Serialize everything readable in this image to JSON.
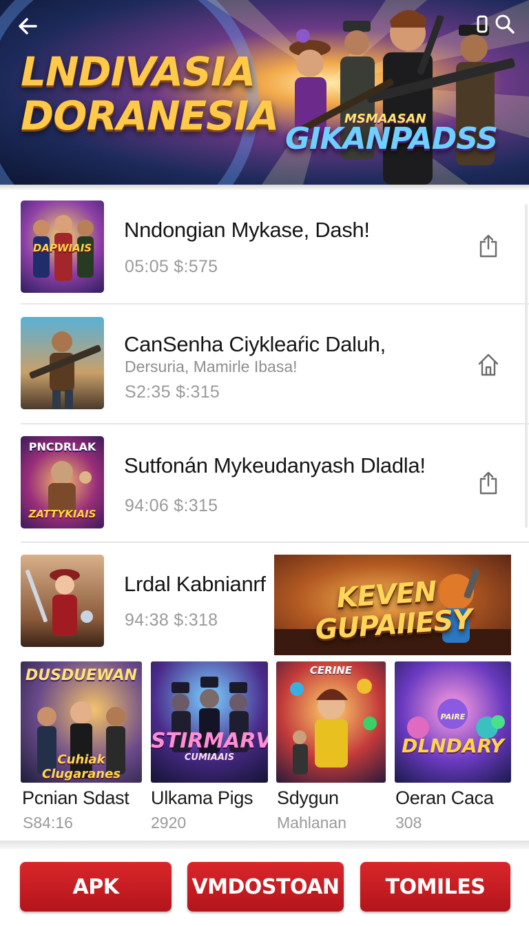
{
  "header": {
    "back_icon": "arrow-left-icon",
    "icons": [
      "phone-icon",
      "search-icon"
    ],
    "banner_title_line1": "LNDIVASIA",
    "banner_title_line2": "DORANESIA",
    "banner_logo_small": "MSMAASAN",
    "banner_logo": "GIKANPADSS"
  },
  "list": {
    "items": [
      {
        "title": "Nndongian Mykase, Dash!",
        "subtitle": "",
        "meta": "05:05  $:575",
        "thumb_text": "DAPWIAIS",
        "action_icon": "share-icon"
      },
      {
        "title": "CanSenha Ciykleaŕic Daluh,",
        "subtitle": "Dersuria, Mamirle Ibasa!",
        "meta": "S2:35  $:315",
        "thumb_text": "",
        "action_icon": "home-icon"
      },
      {
        "title": "Sutfonán Mykeudanyash Dladla!",
        "subtitle": "",
        "meta": "94:06  $:315",
        "thumb_text": "PNCDRLAK",
        "thumb_text2": "ZATTYKIAIS",
        "action_icon": "share-icon"
      },
      {
        "title": "Lrdal Kabnianrf",
        "subtitle": "",
        "meta": "94:38  $:318",
        "thumb_text": "",
        "action_icon": ""
      }
    ]
  },
  "promo": {
    "line1": "KEVEN",
    "line2": "GUPAIIESY"
  },
  "grid": [
    {
      "name": "Pcnian Sdast",
      "meta": "S84:16",
      "art_title": "DUSDUEWAN",
      "art_sub": "Cuhiak Clugaranes"
    },
    {
      "name": "Ulkama Pigs",
      "meta": "2920",
      "art_title": "STIRMARV",
      "art_sub": "CUMIAAIS"
    },
    {
      "name": "Sdygun",
      "meta": "Mahlanan",
      "art_title": "CERINE",
      "art_sub": ""
    },
    {
      "name": "Oeran Caca",
      "meta": "308",
      "art_title": "DLNDARY",
      "art_sub": "PAIRE"
    }
  ],
  "bottom_bar": {
    "buttons": [
      "APK",
      "VMDOSTOAN",
      "TOMILES"
    ]
  },
  "colors": {
    "accent_red": "#c91d22",
    "banner_gold": "#ffc94a"
  }
}
